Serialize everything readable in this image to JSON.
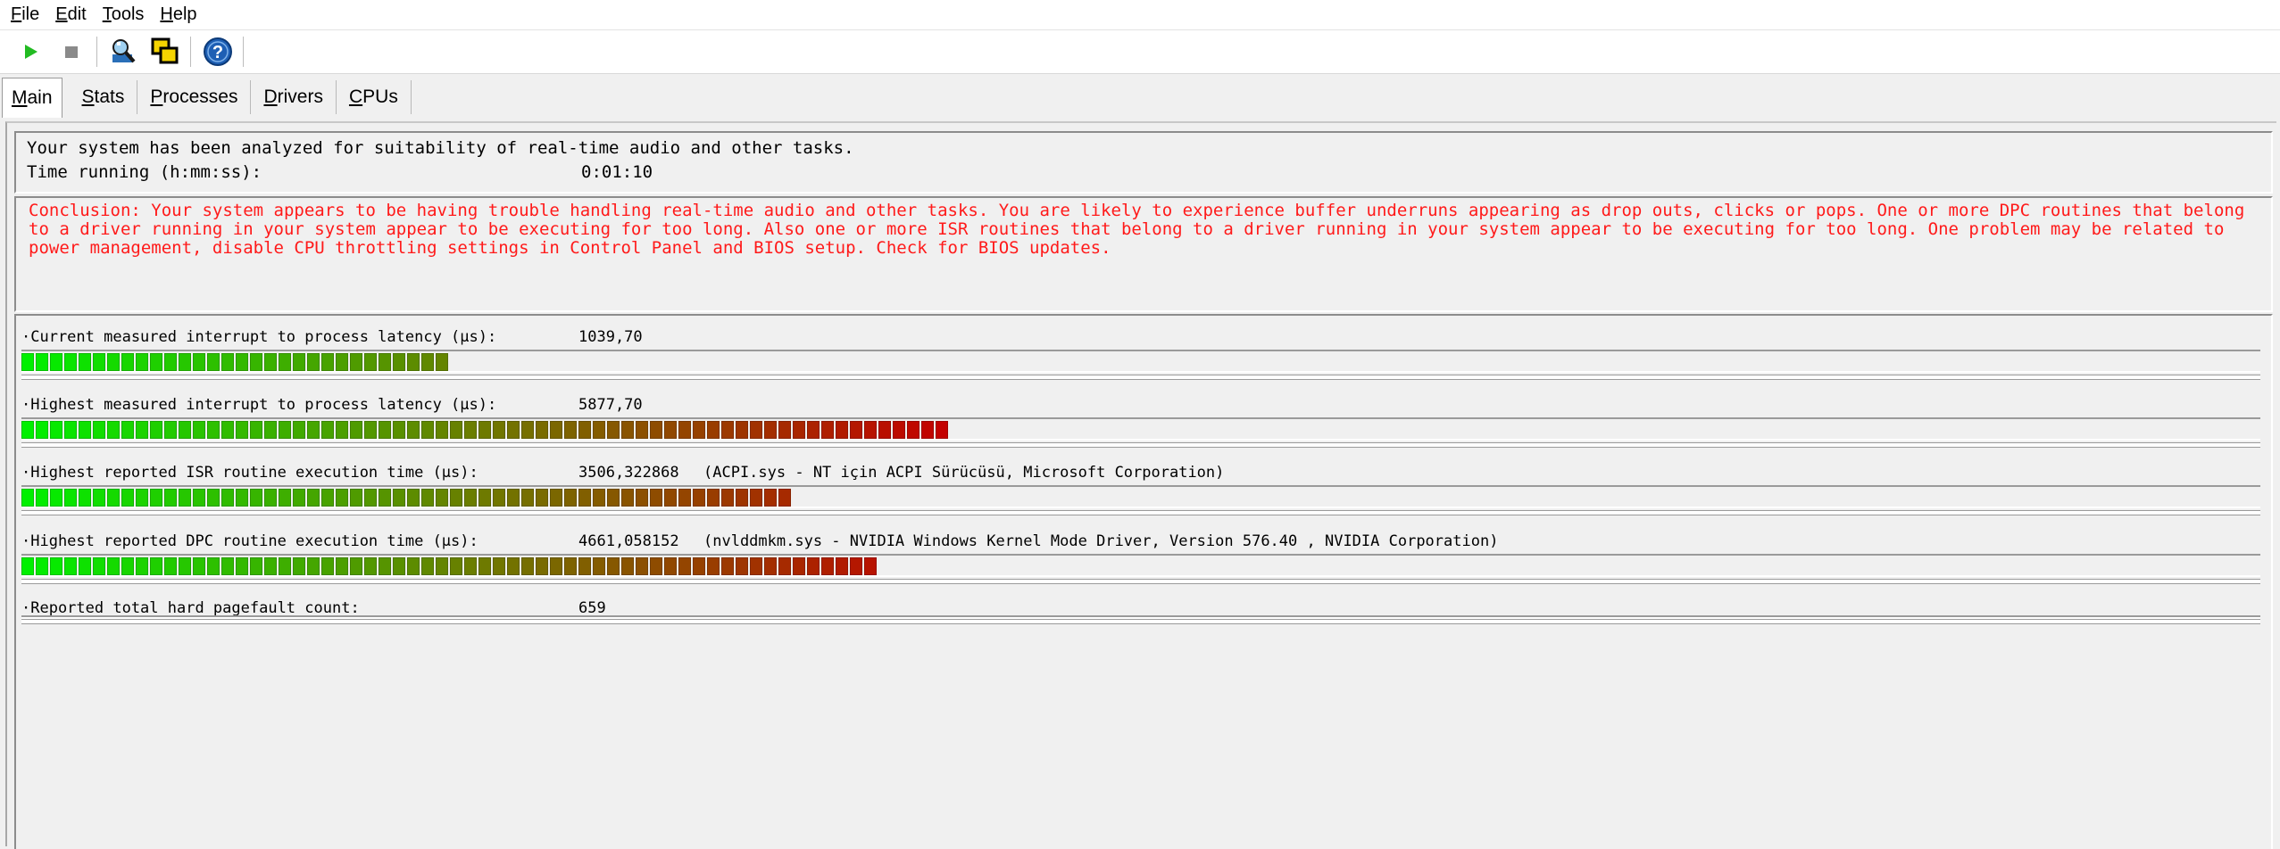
{
  "menu": [
    {
      "mnemonic": "F",
      "rest": "ile"
    },
    {
      "mnemonic": "E",
      "rest": "dit"
    },
    {
      "mnemonic": "T",
      "rest": "ools"
    },
    {
      "mnemonic": "H",
      "rest": "elp"
    }
  ],
  "toolbar": {
    "icons": [
      "play-icon",
      "stop-icon",
      "magnifier-icon",
      "windows-icon",
      "help-icon"
    ],
    "colors": {
      "play": "#22bb22",
      "stop": "#8a8a8a",
      "help": "#1e5fb4"
    }
  },
  "tabs": [
    {
      "mnemonic": "M",
      "rest": "ain",
      "active": true
    },
    {
      "mnemonic": "S",
      "rest": "tats",
      "active": false
    },
    {
      "mnemonic": "P",
      "rest": "rocesses",
      "active": false
    },
    {
      "mnemonic": "D",
      "rest": "rivers",
      "active": false
    },
    {
      "mnemonic": "C",
      "rest": "PUs",
      "active": false
    }
  ],
  "analysis": {
    "headline": "Your system has been analyzed for suitability of real-time audio and other tasks.",
    "time_label": "Time running (h:mm:ss):",
    "time_value": "0:01:10"
  },
  "conclusion": "Conclusion: Your system appears to be having trouble handling real-time audio and other tasks. You are likely to experience buffer underruns appearing as drop outs, clicks or pops. One or more DPC routines that belong to a driver running in your system appear to be executing for too long. Also one or more ISR routines that belong to a driver running in your system appear to be executing for too long. One problem may be related to power management, disable CPU throttling settings in Control Panel and BIOS setup. Check for BIOS updates.",
  "metrics": [
    {
      "label": "·Current measured interrupt to process latency (µs):",
      "value": "1039,70",
      "extra": "",
      "segments": 30
    },
    {
      "label": "·Highest measured interrupt to process latency (µs):",
      "value": "5877,70",
      "extra": "",
      "segments": 65
    },
    {
      "label": "·Highest reported ISR routine execution time (µs):",
      "value": "3506,322868",
      "extra": "(ACPI.sys - NT için ACPI Sürücüsü, Microsoft Corporation)",
      "segments": 54
    },
    {
      "label": "·Highest reported DPC routine execution time (µs):",
      "value": "4661,058152",
      "extra": "(nvlddmkm.sys - NVIDIA Windows Kernel Mode Driver, Version 576.40 , NVIDIA Corporation)",
      "segments": 60
    },
    {
      "label": "·Reported total hard pagefault count:",
      "value": "659",
      "extra": "",
      "segments": 0
    }
  ],
  "bar_colors": {
    "start": "#00f000",
    "mid": "#6e7a00",
    "end": "#c40000"
  },
  "bar_full_scale_segments": 100
}
